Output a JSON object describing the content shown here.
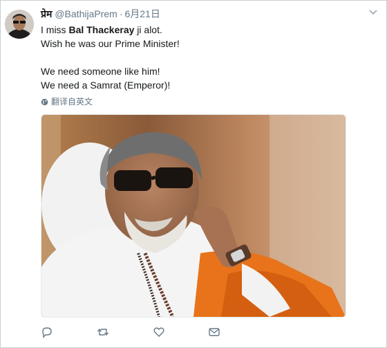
{
  "tweet": {
    "display_name": "प्रेम",
    "handle": "@BathijaPrem",
    "separator": "·",
    "timestamp": "6月21日",
    "text": {
      "line1_pre": "I miss ",
      "line1_bold": "Bal Thackeray",
      "line1_post": " ji alot.",
      "line2": "Wish he was our Prime Minister!",
      "line3": "We need someone like him!",
      "line4": "We need a Samrat (Emperor)!"
    },
    "translate_label": "翻译自英文"
  },
  "actions": [
    "reply-icon",
    "retweet-icon",
    "like-icon",
    "message-icon"
  ],
  "colors": {
    "text": "#14171a",
    "secondary": "#657786",
    "border": "#c8ced2",
    "saffron": "#e8731a"
  }
}
